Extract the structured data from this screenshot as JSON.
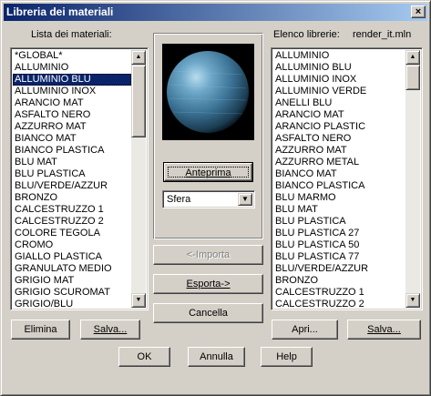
{
  "window": {
    "title": "Libreria dei materiali",
    "close": "×"
  },
  "left": {
    "label": "Lista dei materiali:",
    "items": [
      "*GLOBAL*",
      "ALLUMINIO",
      "ALLUMINIO BLU",
      "ALLUMINIO INOX",
      "ARANCIO MAT",
      "ASFALTO NERO",
      "AZZURRO MAT",
      "BIANCO MAT",
      "BIANCO PLASTICA",
      "BLU MAT",
      "BLU PLASTICA",
      "BLU/VERDE/AZZUR",
      "BRONZO",
      "CALCESTRUZZO 1",
      "CALCESTRUZZO 2",
      "COLORE TEGOLA",
      "CROMO",
      "GIALLO PLASTICA",
      "GRANULATO MEDIO",
      "GRIGIO MAT",
      "GRIGIO SCUROMAT",
      "GRIGIO/BLU"
    ],
    "selected_index": 2
  },
  "right": {
    "label": "Elenco librerie:",
    "file": "render_it.mln",
    "items": [
      "ALLUMINIO",
      "ALLUMINIO BLU",
      "ALLUMINIO INOX",
      "ALLUMINIO VERDE",
      "ANELLI BLU",
      "ARANCIO MAT",
      "ARANCIO PLASTIC",
      "ASFALTO NERO",
      "AZZURRO MAT",
      "AZZURRO METAL",
      "BIANCO MAT",
      "BIANCO PLASTICA",
      "BLU MARMO",
      "BLU MAT",
      "BLU PLASTICA",
      "BLU PLASTICA 27",
      "BLU PLASTICA 50",
      "BLU PLASTICA 77",
      "BLU/VERDE/AZZUR",
      "BRONZO",
      "CALCESTRUZZO 1",
      "CALCESTRUZZO 2"
    ]
  },
  "center": {
    "preview_button": "Anteprima",
    "shape_value": "Sfera",
    "import_button": "<-Importa",
    "export_button": "Esporta->",
    "cancel_button": "Cancella"
  },
  "buttons": {
    "delete": "Elimina",
    "save_left": "Salva...",
    "open": "Apri...",
    "save_right": "Salva...",
    "ok": "OK",
    "cancel": "Annulla",
    "help": "Help"
  },
  "colors": {
    "titlebar_start": "#0a246a",
    "titlebar_end": "#a6caf0",
    "selection": "#0a246a",
    "face": "#d4d0c8"
  }
}
